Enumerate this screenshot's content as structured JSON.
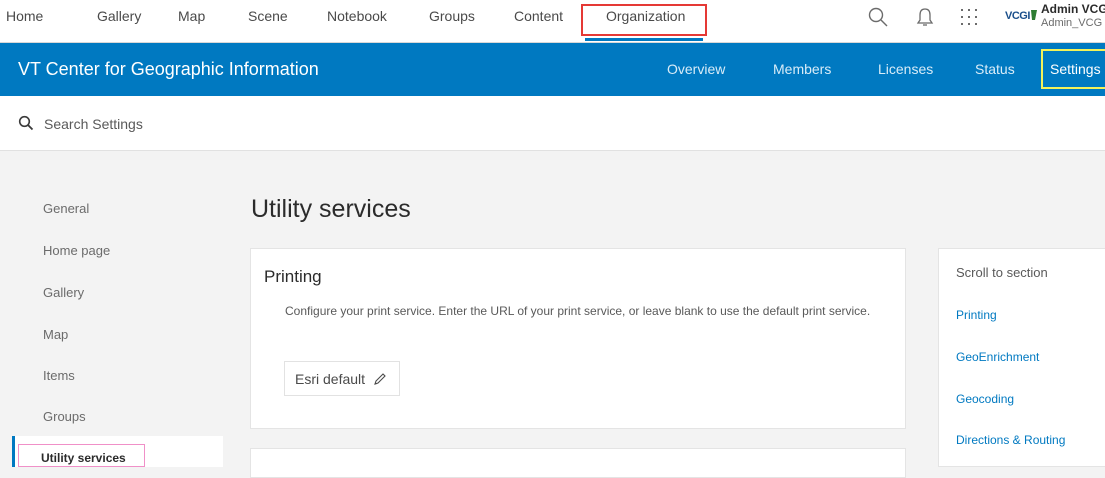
{
  "topnav": {
    "items": [
      "Home",
      "Gallery",
      "Map",
      "Scene",
      "Notebook",
      "Groups",
      "Content",
      "Organization"
    ],
    "active_index": 7,
    "search_icon": "search-icon",
    "notifications_icon": "bell-icon",
    "apps_icon": "grid-icon",
    "logo_text": "VCGI",
    "user_name": "Admin VCG",
    "user_sub": "Admin_VCG"
  },
  "orgbar": {
    "title": "VT Center for Geographic Information",
    "tabs": [
      "Overview",
      "Members",
      "Licenses",
      "Status",
      "Settings"
    ],
    "active_tab": "Settings"
  },
  "search": {
    "placeholder": "Search Settings",
    "value": ""
  },
  "sidenav": {
    "items": [
      "General",
      "Home page",
      "Gallery",
      "Map",
      "Items",
      "Groups",
      "Utility services"
    ],
    "active": "Utility services"
  },
  "main": {
    "page_title": "Utility services",
    "printing": {
      "title": "Printing",
      "description": "Configure your print service. Enter the URL of your print service, or leave blank to use the default print service.",
      "value": "Esri default",
      "edit_icon": "pencil-icon"
    }
  },
  "scroll_panel": {
    "title": "Scroll to section",
    "links": [
      "Printing",
      "GeoEnrichment",
      "Geocoding",
      "Directions & Routing"
    ]
  },
  "colors": {
    "brand_blue": "#0079c1",
    "highlight_red": "#e53935",
    "highlight_yellow": "#f2f25a",
    "highlight_pink": "#f090c8"
  }
}
